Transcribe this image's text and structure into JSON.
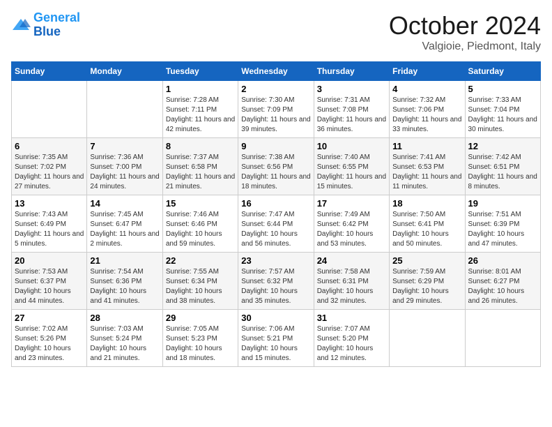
{
  "header": {
    "logo_line1": "General",
    "logo_line2": "Blue",
    "month": "October 2024",
    "location": "Valgioie, Piedmont, Italy"
  },
  "days_header": [
    "Sunday",
    "Monday",
    "Tuesday",
    "Wednesday",
    "Thursday",
    "Friday",
    "Saturday"
  ],
  "weeks": [
    [
      {
        "num": "",
        "info": ""
      },
      {
        "num": "",
        "info": ""
      },
      {
        "num": "1",
        "info": "Sunrise: 7:28 AM\nSunset: 7:11 PM\nDaylight: 11 hours and 42 minutes."
      },
      {
        "num": "2",
        "info": "Sunrise: 7:30 AM\nSunset: 7:09 PM\nDaylight: 11 hours and 39 minutes."
      },
      {
        "num": "3",
        "info": "Sunrise: 7:31 AM\nSunset: 7:08 PM\nDaylight: 11 hours and 36 minutes."
      },
      {
        "num": "4",
        "info": "Sunrise: 7:32 AM\nSunset: 7:06 PM\nDaylight: 11 hours and 33 minutes."
      },
      {
        "num": "5",
        "info": "Sunrise: 7:33 AM\nSunset: 7:04 PM\nDaylight: 11 hours and 30 minutes."
      }
    ],
    [
      {
        "num": "6",
        "info": "Sunrise: 7:35 AM\nSunset: 7:02 PM\nDaylight: 11 hours and 27 minutes."
      },
      {
        "num": "7",
        "info": "Sunrise: 7:36 AM\nSunset: 7:00 PM\nDaylight: 11 hours and 24 minutes."
      },
      {
        "num": "8",
        "info": "Sunrise: 7:37 AM\nSunset: 6:58 PM\nDaylight: 11 hours and 21 minutes."
      },
      {
        "num": "9",
        "info": "Sunrise: 7:38 AM\nSunset: 6:56 PM\nDaylight: 11 hours and 18 minutes."
      },
      {
        "num": "10",
        "info": "Sunrise: 7:40 AM\nSunset: 6:55 PM\nDaylight: 11 hours and 15 minutes."
      },
      {
        "num": "11",
        "info": "Sunrise: 7:41 AM\nSunset: 6:53 PM\nDaylight: 11 hours and 11 minutes."
      },
      {
        "num": "12",
        "info": "Sunrise: 7:42 AM\nSunset: 6:51 PM\nDaylight: 11 hours and 8 minutes."
      }
    ],
    [
      {
        "num": "13",
        "info": "Sunrise: 7:43 AM\nSunset: 6:49 PM\nDaylight: 11 hours and 5 minutes."
      },
      {
        "num": "14",
        "info": "Sunrise: 7:45 AM\nSunset: 6:47 PM\nDaylight: 11 hours and 2 minutes."
      },
      {
        "num": "15",
        "info": "Sunrise: 7:46 AM\nSunset: 6:46 PM\nDaylight: 10 hours and 59 minutes."
      },
      {
        "num": "16",
        "info": "Sunrise: 7:47 AM\nSunset: 6:44 PM\nDaylight: 10 hours and 56 minutes."
      },
      {
        "num": "17",
        "info": "Sunrise: 7:49 AM\nSunset: 6:42 PM\nDaylight: 10 hours and 53 minutes."
      },
      {
        "num": "18",
        "info": "Sunrise: 7:50 AM\nSunset: 6:41 PM\nDaylight: 10 hours and 50 minutes."
      },
      {
        "num": "19",
        "info": "Sunrise: 7:51 AM\nSunset: 6:39 PM\nDaylight: 10 hours and 47 minutes."
      }
    ],
    [
      {
        "num": "20",
        "info": "Sunrise: 7:53 AM\nSunset: 6:37 PM\nDaylight: 10 hours and 44 minutes."
      },
      {
        "num": "21",
        "info": "Sunrise: 7:54 AM\nSunset: 6:36 PM\nDaylight: 10 hours and 41 minutes."
      },
      {
        "num": "22",
        "info": "Sunrise: 7:55 AM\nSunset: 6:34 PM\nDaylight: 10 hours and 38 minutes."
      },
      {
        "num": "23",
        "info": "Sunrise: 7:57 AM\nSunset: 6:32 PM\nDaylight: 10 hours and 35 minutes."
      },
      {
        "num": "24",
        "info": "Sunrise: 7:58 AM\nSunset: 6:31 PM\nDaylight: 10 hours and 32 minutes."
      },
      {
        "num": "25",
        "info": "Sunrise: 7:59 AM\nSunset: 6:29 PM\nDaylight: 10 hours and 29 minutes."
      },
      {
        "num": "26",
        "info": "Sunrise: 8:01 AM\nSunset: 6:27 PM\nDaylight: 10 hours and 26 minutes."
      }
    ],
    [
      {
        "num": "27",
        "info": "Sunrise: 7:02 AM\nSunset: 5:26 PM\nDaylight: 10 hours and 23 minutes."
      },
      {
        "num": "28",
        "info": "Sunrise: 7:03 AM\nSunset: 5:24 PM\nDaylight: 10 hours and 21 minutes."
      },
      {
        "num": "29",
        "info": "Sunrise: 7:05 AM\nSunset: 5:23 PM\nDaylight: 10 hours and 18 minutes."
      },
      {
        "num": "30",
        "info": "Sunrise: 7:06 AM\nSunset: 5:21 PM\nDaylight: 10 hours and 15 minutes."
      },
      {
        "num": "31",
        "info": "Sunrise: 7:07 AM\nSunset: 5:20 PM\nDaylight: 10 hours and 12 minutes."
      },
      {
        "num": "",
        "info": ""
      },
      {
        "num": "",
        "info": ""
      }
    ]
  ]
}
